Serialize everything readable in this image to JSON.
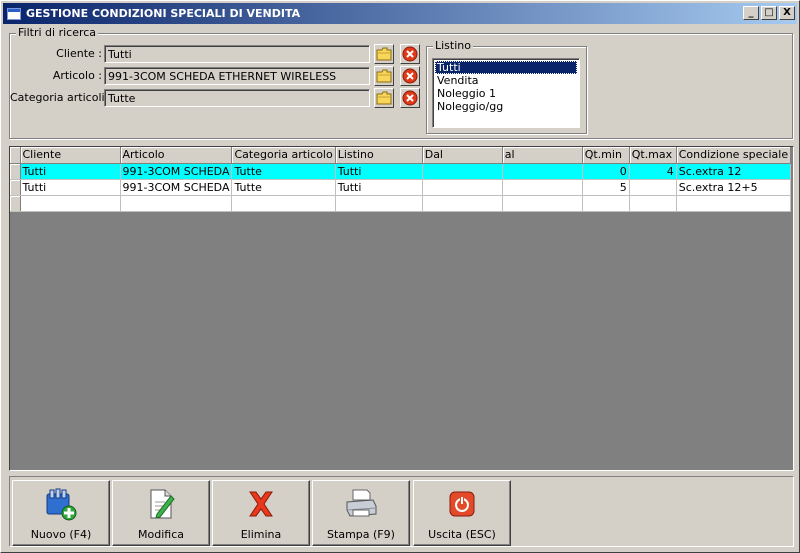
{
  "window": {
    "title": "GESTIONE CONDIZIONI SPECIALI DI VENDITA",
    "controls": [
      "_",
      "□",
      "X"
    ]
  },
  "filters": {
    "legend": "Filtri di ricerca",
    "cliente": {
      "label": "Cliente :",
      "value": "Tutti"
    },
    "articolo": {
      "label": "Articolo :",
      "value": "991-3COM SCHEDA ETHERNET WIRELESS"
    },
    "categoria": {
      "label": "Categoria articoli :",
      "value": "Tutte"
    }
  },
  "listino": {
    "legend": "Listino",
    "items": [
      "Tutti",
      "Vendita",
      "Noleggio 1",
      "Noleggio/gg"
    ],
    "selected": "Tutti"
  },
  "grid": {
    "columns": [
      "Cliente",
      "Articolo",
      "Categoria articolo",
      "Listino",
      "Dal",
      "al",
      "Qt.min",
      "Qt.max",
      "Condizione speciale"
    ],
    "rows": [
      [
        "Tutti",
        "991-3COM SCHEDA",
        "Tutte",
        "Tutti",
        "",
        "",
        "0",
        "4",
        "Sc.extra 12"
      ],
      [
        "Tutti",
        "991-3COM SCHEDA",
        "Tutte",
        "Tutti",
        "",
        "",
        "5",
        "",
        "Sc.extra 12+5"
      ],
      [
        "",
        "",
        "",
        "",
        "",
        "",
        "",
        "",
        ""
      ]
    ],
    "selected_row": 0,
    "selection_color": "#00ffff"
  },
  "toolbar": {
    "nuovo": "Nuovo (F4)",
    "modifica": "Modifica",
    "elimina": "Elimina",
    "stampa": "Stampa (F9)",
    "uscita": "Uscita (ESC)"
  },
  "icons": {
    "folder": "folder-icon",
    "clear": "clear-icon",
    "new": "new-record-icon",
    "edit": "edit-icon",
    "delete": "delete-x-icon",
    "print": "printer-icon",
    "exit": "power-icon"
  },
  "colors": {
    "titlebar_start": "#0a246a",
    "titlebar_end": "#a6caf0",
    "face": "#d4d0c8",
    "grid_bg": "#808080",
    "row_highlight": "#00ffff"
  }
}
